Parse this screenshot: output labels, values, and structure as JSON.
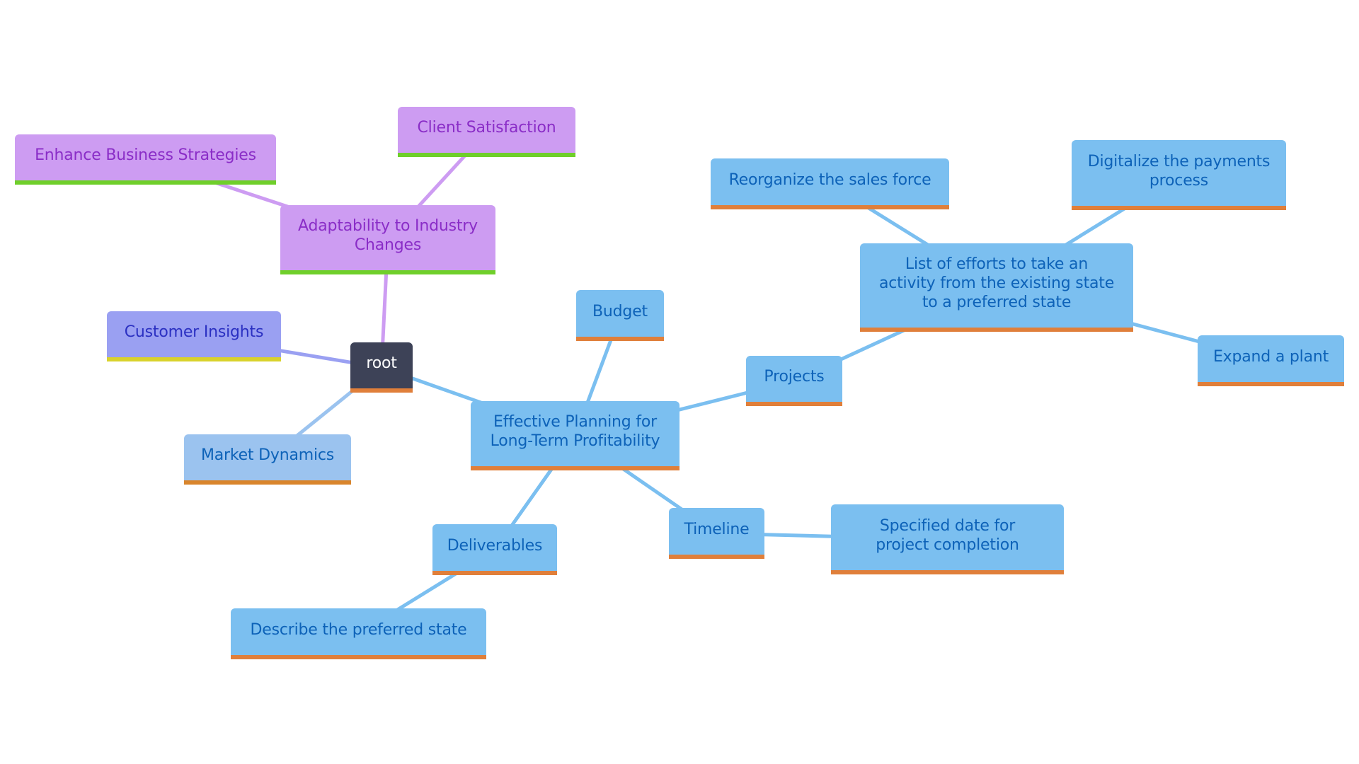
{
  "diagram": {
    "type": "mindmap",
    "colors": {
      "root_fill": "#3d4257",
      "blue_fill": "#7bbff0",
      "blue_text": "#0d62b8",
      "orange_border": "#e07f3a",
      "purple_fill": "#cd9cf2",
      "purple_text": "#8a2dc7",
      "green_border": "#6fcf2a",
      "indigo_fill": "#9aa0f2",
      "yellow_border": "#d9d22c",
      "lightblue_fill": "#9bc3ef"
    },
    "nodes": {
      "root": "root",
      "adaptability": "Adaptability to Industry Changes",
      "enhance": "Enhance Business Strategies",
      "client": "Client Satisfaction",
      "customer": "Customer Insights",
      "market": "Market Dynamics",
      "effective": "Effective Planning for Long-Term Profitability",
      "budget": "Budget",
      "projects": "Projects",
      "list": "List of efforts to take an activity from the existing state to a preferred state",
      "reorganize": "Reorganize the sales force",
      "digitalize": "Digitalize the payments process",
      "expand": "Expand a plant",
      "timeline": "Timeline",
      "specified": "Specified date for project completion",
      "deliverables": "Deliverables",
      "describe": "Describe the preferred state"
    },
    "edges": [
      [
        "root",
        "adaptability"
      ],
      [
        "adaptability",
        "enhance"
      ],
      [
        "adaptability",
        "client"
      ],
      [
        "root",
        "customer"
      ],
      [
        "root",
        "market"
      ],
      [
        "root",
        "effective"
      ],
      [
        "effective",
        "budget"
      ],
      [
        "effective",
        "projects"
      ],
      [
        "projects",
        "list"
      ],
      [
        "list",
        "reorganize"
      ],
      [
        "list",
        "digitalize"
      ],
      [
        "list",
        "expand"
      ],
      [
        "effective",
        "timeline"
      ],
      [
        "timeline",
        "specified"
      ],
      [
        "effective",
        "deliverables"
      ],
      [
        "deliverables",
        "describe"
      ]
    ]
  }
}
